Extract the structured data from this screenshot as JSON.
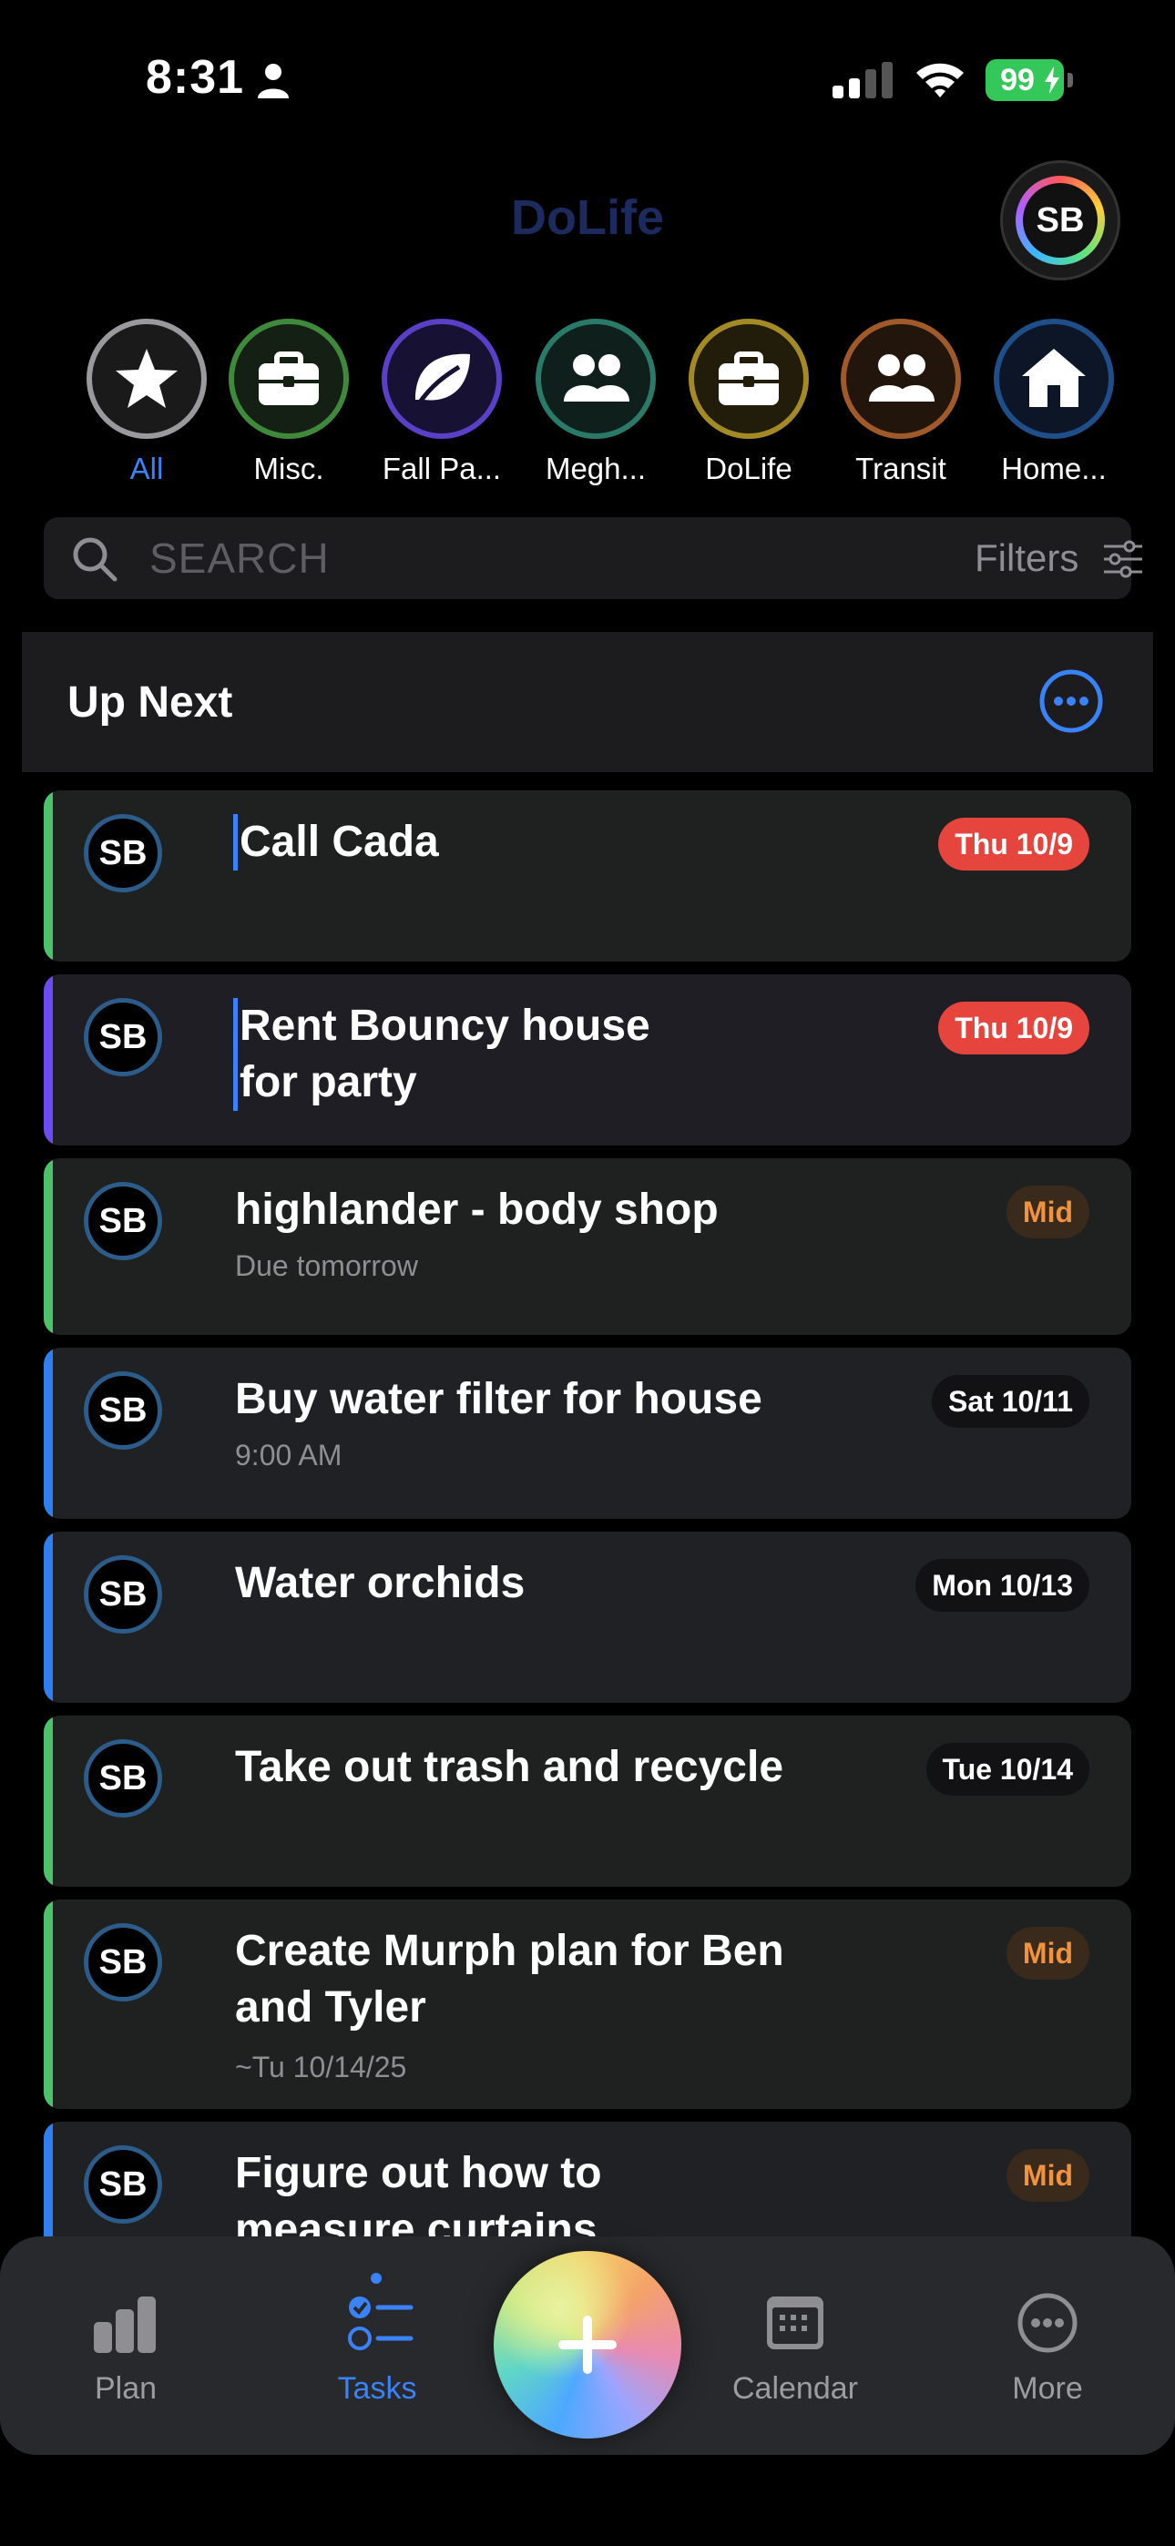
{
  "status_bar": {
    "time": "8:31",
    "battery": "99"
  },
  "header": {
    "app_title": "DoLife",
    "profile_initials": "SB"
  },
  "categories": [
    {
      "label": "All",
      "color": "#9a9a9e",
      "icon": "star-icon",
      "active": true
    },
    {
      "label": "Misc.",
      "color": "#3f8a3a",
      "icon": "briefcase-icon"
    },
    {
      "label": "Fall Pa...",
      "color": "#5a3fc8",
      "icon": "leaf-icon"
    },
    {
      "label": "Megh...",
      "color": "#2a7a6a",
      "icon": "people-icon"
    },
    {
      "label": "DoLife",
      "color": "#a38a25",
      "icon": "briefcase-icon"
    },
    {
      "label": "Transit",
      "color": "#a05a2a",
      "icon": "people-icon"
    },
    {
      "label": "Home...",
      "color": "#1f4f8a",
      "icon": "house-icon"
    }
  ],
  "search": {
    "placeholder": "SEARCH",
    "filters_label": "Filters"
  },
  "section": {
    "title": "Up Next"
  },
  "tasks": [
    {
      "initials": "SB",
      "title": "Call Cada",
      "subtitle": "",
      "badge": "Thu 10/9",
      "badge_style": "red",
      "stripe": "#4cc26a"
    },
    {
      "initials": "SB",
      "title": "Rent Bouncy house for party",
      "subtitle": "",
      "badge": "Thu 10/9",
      "badge_style": "red",
      "stripe": "#6a4cf0"
    },
    {
      "initials": "SB",
      "title": "highlander - body shop",
      "subtitle": "Due tomorrow",
      "badge": "Mid",
      "badge_style": "mid",
      "stripe": "#4cc26a"
    },
    {
      "initials": "SB",
      "title": "Buy water filter for house",
      "subtitle": "9:00 AM",
      "badge": "Sat 10/11",
      "badge_style": "dark",
      "stripe": "#2f7ff0"
    },
    {
      "initials": "SB",
      "title": "Water orchids",
      "subtitle": "",
      "badge": "Mon 10/13",
      "badge_style": "dark",
      "stripe": "#2f7ff0"
    },
    {
      "initials": "SB",
      "title": "Take out trash and recycle",
      "subtitle": "",
      "badge": "Tue 10/14",
      "badge_style": "dark",
      "stripe": "#4cc26a"
    },
    {
      "initials": "SB",
      "title": "Create Murph plan for Ben and Tyler",
      "subtitle": "~Tu 10/14/25",
      "badge": "Mid",
      "badge_style": "mid",
      "stripe": "#4cc26a"
    },
    {
      "initials": "SB",
      "title": "Figure out how to measure curtains",
      "subtitle": "",
      "badge": "Mid",
      "badge_style": "mid",
      "stripe": "#2f7ff0"
    }
  ],
  "tab_bar": {
    "plan": "Plan",
    "tasks": "Tasks",
    "calendar": "Calendar",
    "more": "More"
  }
}
